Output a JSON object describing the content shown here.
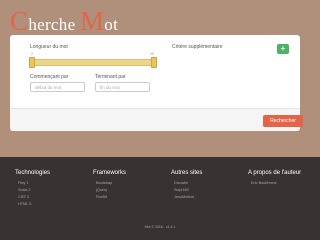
{
  "header": {
    "title_c": "C",
    "title_rest1": "herche ",
    "title_m": "M",
    "title_rest2": "ot"
  },
  "form": {
    "length_label": "Longueur du mot",
    "length_min": "2",
    "length_max": "25",
    "length_range": [
      2,
      25
    ],
    "criteria_label": "Critère supplémentaire",
    "add_label": "+",
    "starts_label": "Commençant par",
    "starts_placeholder": "début du mot",
    "ends_label": "Terminant par",
    "ends_placeholder": "fin du mot",
    "search_label": "Rechercher"
  },
  "footer": {
    "technologies": {
      "title": "Technologies",
      "items": [
        "Play 1",
        "Scala 2",
        "CSS 3",
        "HTML 5"
      ]
    },
    "frameworks": {
      "title": "Frameworks",
      "items": [
        "Bootstrap",
        "jQuery",
        "FireBit"
      ]
    },
    "other_sites": {
      "title": "Autres sites",
      "items": [
        "Dicowiki",
        "Scipt160",
        "JesuMobios"
      ]
    },
    "about": {
      "title": "A propos de l'auteur",
      "items": [
        "Eric Boulfresne"
      ]
    },
    "copyright": "Mot © 2016 - v1.4.1"
  },
  "colors": {
    "accent": "#e4644a",
    "background": "#b0907a",
    "footer": "#383332",
    "success": "#4bb268",
    "slider": "#ecd68c"
  }
}
